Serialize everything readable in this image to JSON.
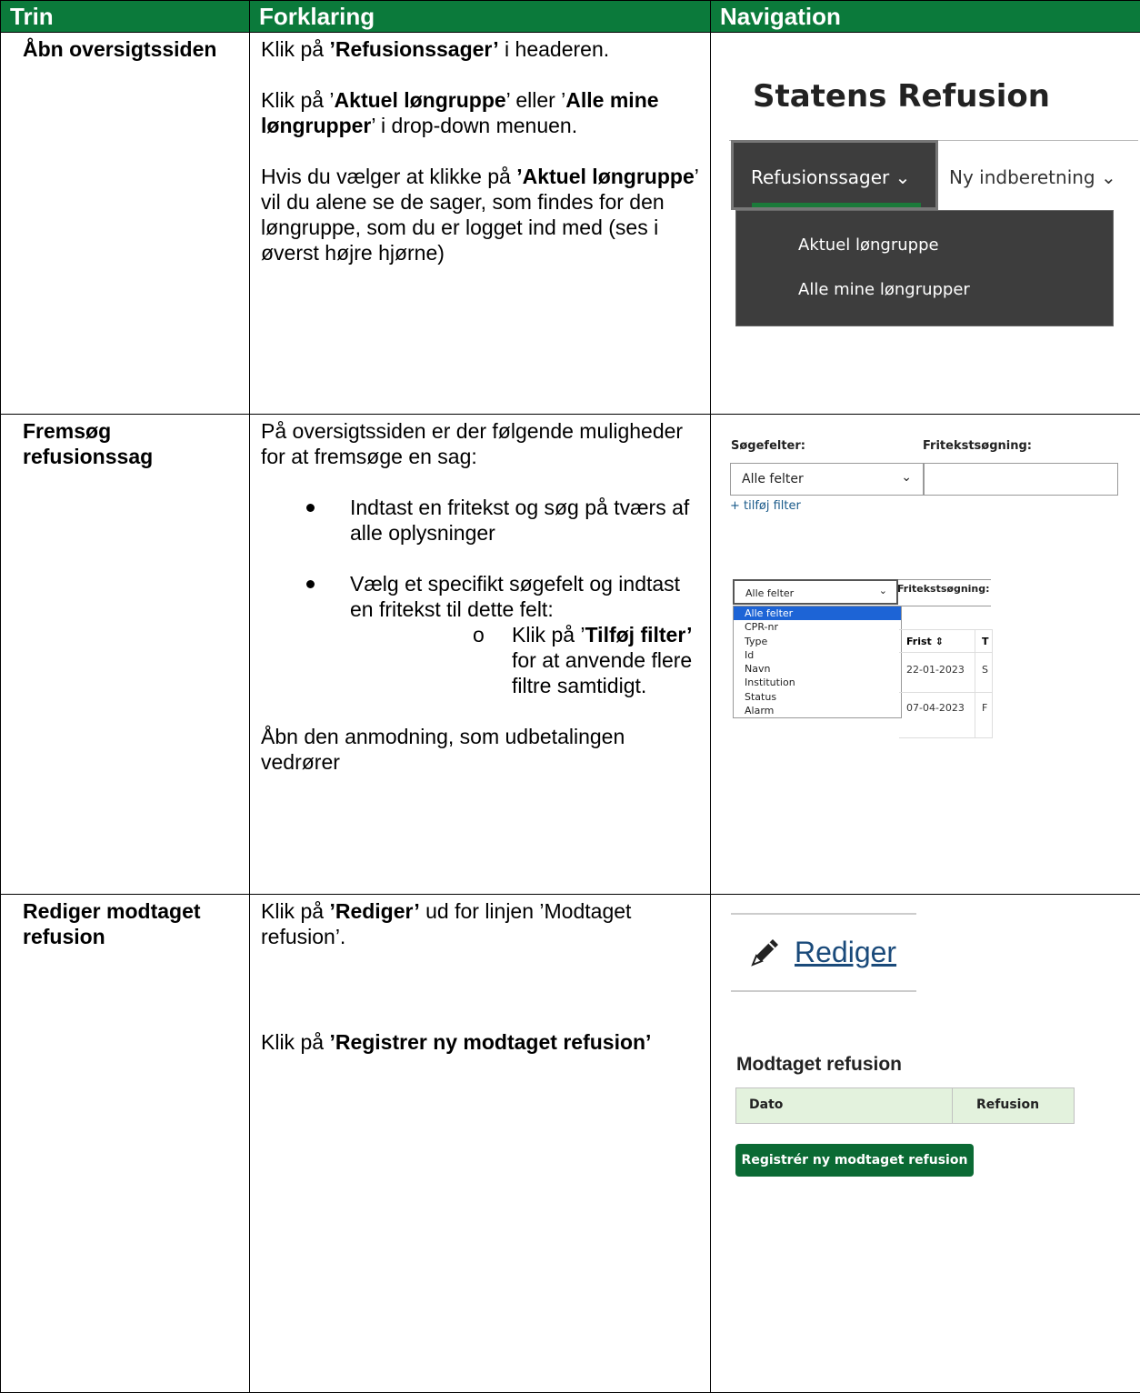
{
  "headers": [
    "Trin",
    "Forklaring",
    "Navigation"
  ],
  "row1": {
    "step": "Åbn oversigtssiden",
    "p1": {
      "a": "Klik på ",
      "b": "’Refusionssager’",
      "c": " i headeren."
    },
    "p2": {
      "a": "Klik på ’",
      "b": "Aktuel løngruppe",
      "c": "’ eller ’",
      "d": "Alle mine løngrupper",
      "e": "’ i drop-down menuen."
    },
    "p3": {
      "a": "Hvis du vælger at klikke på ",
      "b": "’Aktuel løngruppe",
      "c": "’ vil du alene se de sager, som findes for den løngruppe, som du er logget ind med (ses i øverst højre hjørne)"
    },
    "nav": {
      "brand": "Statens Refusion",
      "menu_refusionssager": "Refusionssager",
      "menu_ny": "Ny indberetning",
      "dropdown_items": [
        "Aktuel løngruppe",
        "Alle mine løngrupper"
      ]
    }
  },
  "row2": {
    "step": "Fremsøg refusionssag",
    "intro": "På oversigtssiden er der følgende muligheder for at fremsøge en sag:",
    "bullet1": "Indtast en fritekst og søg på tværs af alle oplysninger",
    "bullet2": "Vælg et specifikt søgefelt og indtast en fritekst til dette felt:",
    "sub": {
      "a": "Klik på ’",
      "b": "Tilføj filter’",
      "c": " for at anvende flere filtre samtidigt."
    },
    "closing": "Åbn den anmodning, som udbetalingen vedrører",
    "nav": {
      "label_sogefelter": "Søgefelter:",
      "label_fritekst": "Fritekstsøgning:",
      "select_value": "Alle felter",
      "add_filter": "+ tilføj filter",
      "options": [
        "Alle felter",
        "CPR-nr",
        "Type",
        "Id",
        "Navn",
        "Institution",
        "Status",
        "Alarm"
      ],
      "col_frist": "Frist ⇕",
      "col_t": "T",
      "date1": "22-01-2023",
      "cell1": "S",
      "date2": "07-04-2023",
      "cell2": "F"
    }
  },
  "row3": {
    "step": "Rediger modtaget refusion",
    "p1": {
      "a": "Klik på ",
      "b": "’Rediger’",
      "c": " ud for linjen ’Modtaget refusion’."
    },
    "p2": {
      "a": "Klik på ",
      "b": "’Registrer ny modtaget refusion’"
    },
    "nav": {
      "rediger": "Rediger",
      "section_title": "Modtaget refusion",
      "col_dato": "Dato",
      "col_refusion": "Refusion",
      "button": "Registrér ny modtaget refusion"
    }
  }
}
